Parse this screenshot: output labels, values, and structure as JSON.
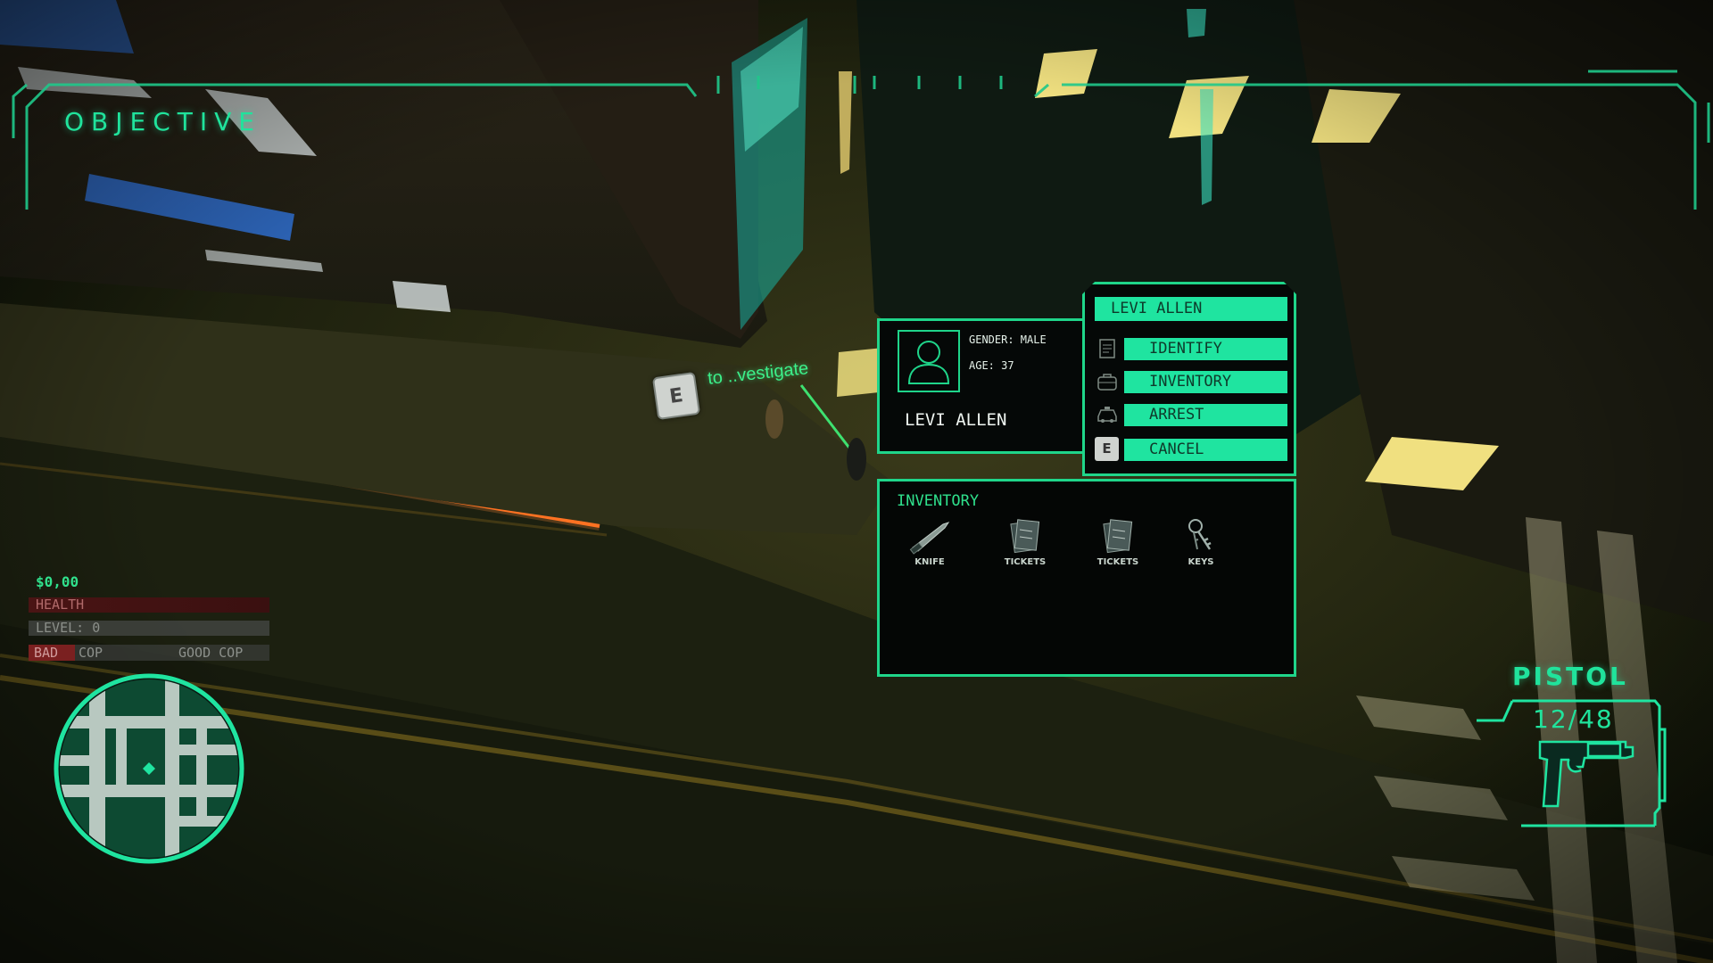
{
  "hud": {
    "objective_title": "OBJECTIVE",
    "world_prompt": "to ..vestigate",
    "world_prompt_key": "E"
  },
  "player": {
    "money": "$0,00",
    "health_label": "HEALTH",
    "level_label": "LEVEL: 0",
    "bad_label": "BAD",
    "bad_cop_label": "COP",
    "good_cop_label": "GOOD  COP"
  },
  "suspect": {
    "gender": "GENDER: MALE",
    "age": "AGE: 37",
    "name": "LEVI ALLEN"
  },
  "action_menu": {
    "title": "LEVI ALLEN",
    "items": [
      {
        "label": "IDENTIFY",
        "icon": "document-icon"
      },
      {
        "label": "INVENTORY",
        "icon": "bag-icon"
      },
      {
        "label": "ARREST",
        "icon": "police-car-icon"
      },
      {
        "label": "CANCEL",
        "icon": "e-key-icon",
        "key": "E"
      }
    ]
  },
  "inventory": {
    "title": "INVENTORY",
    "items": [
      {
        "label": "KNIFE",
        "icon": "knife-icon"
      },
      {
        "label": "TICKETS",
        "icon": "tickets-icon"
      },
      {
        "label": "TICKETS",
        "icon": "tickets-icon"
      },
      {
        "label": "KEYS",
        "icon": "keys-icon"
      }
    ]
  },
  "weapon": {
    "name": "PISTOL",
    "ammo": "12/48"
  },
  "colors": {
    "hud_accent": "#1fe4a0",
    "health_bar": "#4a1414",
    "bad_cop": "#7a2020"
  }
}
